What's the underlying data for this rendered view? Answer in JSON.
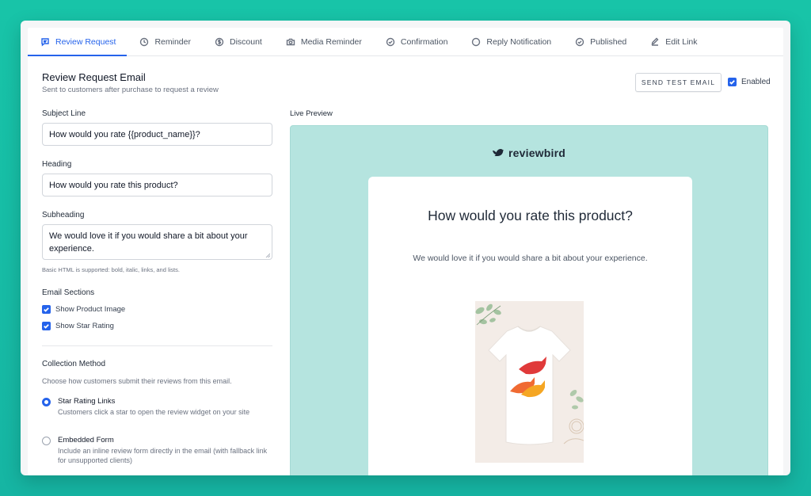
{
  "tabs": [
    {
      "label": "Review Request",
      "icon": "chat-bubble-icon",
      "active": true
    },
    {
      "label": "Reminder",
      "icon": "clock-icon",
      "active": false
    },
    {
      "label": "Discount",
      "icon": "dollar-circle-icon",
      "active": false
    },
    {
      "label": "Media Reminder",
      "icon": "camera-icon",
      "active": false
    },
    {
      "label": "Confirmation",
      "icon": "check-circle-icon",
      "active": false
    },
    {
      "label": "Reply Notification",
      "icon": "dots-circle-icon",
      "active": false
    },
    {
      "label": "Published",
      "icon": "check-circle-icon",
      "active": false
    },
    {
      "label": "Edit Link",
      "icon": "edit-icon",
      "active": false
    }
  ],
  "header": {
    "title": "Review Request Email",
    "subtitle": "Sent to customers after purchase to request a review",
    "send_test_label": "SEND TEST EMAIL",
    "enabled_label": "Enabled",
    "enabled_checked": true
  },
  "form": {
    "subject_label": "Subject Line",
    "subject_value": "How would you rate {{product_name}}?",
    "heading_label": "Heading",
    "heading_value": "How would you rate this product?",
    "subheading_label": "Subheading",
    "subheading_value": "We would love it if you would share a bit about your experience.",
    "html_hint": "Basic HTML is supported: bold, italic, links, and lists.",
    "sections_label": "Email Sections",
    "show_product_image_label": "Show Product Image",
    "show_product_image_checked": true,
    "show_star_rating_label": "Show Star Rating",
    "show_star_rating_checked": true,
    "collection_label": "Collection Method",
    "collection_desc": "Choose how customers submit their reviews from this email.",
    "options": [
      {
        "title": "Star Rating Links",
        "desc": "Customers click a star to open the review widget on your site",
        "selected": true
      },
      {
        "title": "Embedded Form",
        "desc": "Include an inline review form directly in the email (with fallback link for unsupported clients)",
        "selected": false
      }
    ]
  },
  "preview": {
    "label": "Live Preview",
    "brand": "reviewbird",
    "heading": "How would you rate this product?",
    "subheading": "We would love it if you would share a bit about your experience.",
    "background_color": "#b5e4df"
  },
  "colors": {
    "accent": "#2563eb",
    "page_bg": "#18c4a8"
  }
}
